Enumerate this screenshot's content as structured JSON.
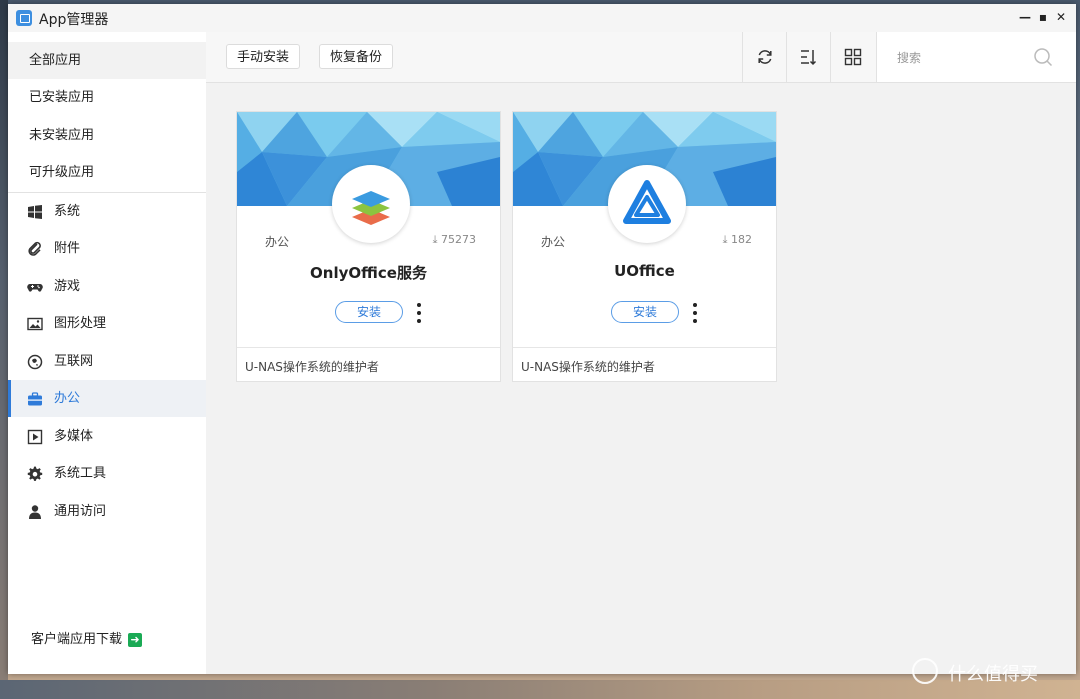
{
  "window": {
    "title": "App管理器"
  },
  "sidebar": {
    "top_items": [
      {
        "label": "全部应用"
      },
      {
        "label": "已安装应用"
      },
      {
        "label": "未安装应用"
      },
      {
        "label": "可升级应用"
      }
    ],
    "categories": [
      {
        "label": "系统",
        "icon": "windows-icon"
      },
      {
        "label": "附件",
        "icon": "paperclip-icon"
      },
      {
        "label": "游戏",
        "icon": "gamepad-icon"
      },
      {
        "label": "图形处理",
        "icon": "image-icon"
      },
      {
        "label": "互联网",
        "icon": "globe-icon"
      },
      {
        "label": "办公",
        "icon": "briefcase-icon",
        "active": true
      },
      {
        "label": "多媒体",
        "icon": "play-icon"
      },
      {
        "label": "系统工具",
        "icon": "gear-icon"
      },
      {
        "label": "通用访问",
        "icon": "user-icon"
      }
    ],
    "client_download": "客户端应用下载"
  },
  "toolbar": {
    "manual_install": "手动安装",
    "restore_backup": "恢复备份",
    "search_placeholder": "搜索"
  },
  "apps": [
    {
      "name": "OnlyOffice服务",
      "category": "办公",
      "downloads": "75273",
      "install_label": "安装",
      "maintainer": "U-NAS操作系统的维护者"
    },
    {
      "name": "UOffice",
      "category": "办公",
      "downloads": "182",
      "install_label": "安装",
      "maintainer": "U-NAS操作系统的维护者"
    }
  ],
  "watermark": {
    "text": "什么值得买"
  },
  "colors": {
    "accent": "#2f7bd9",
    "active_bg": "#eef1f5"
  }
}
